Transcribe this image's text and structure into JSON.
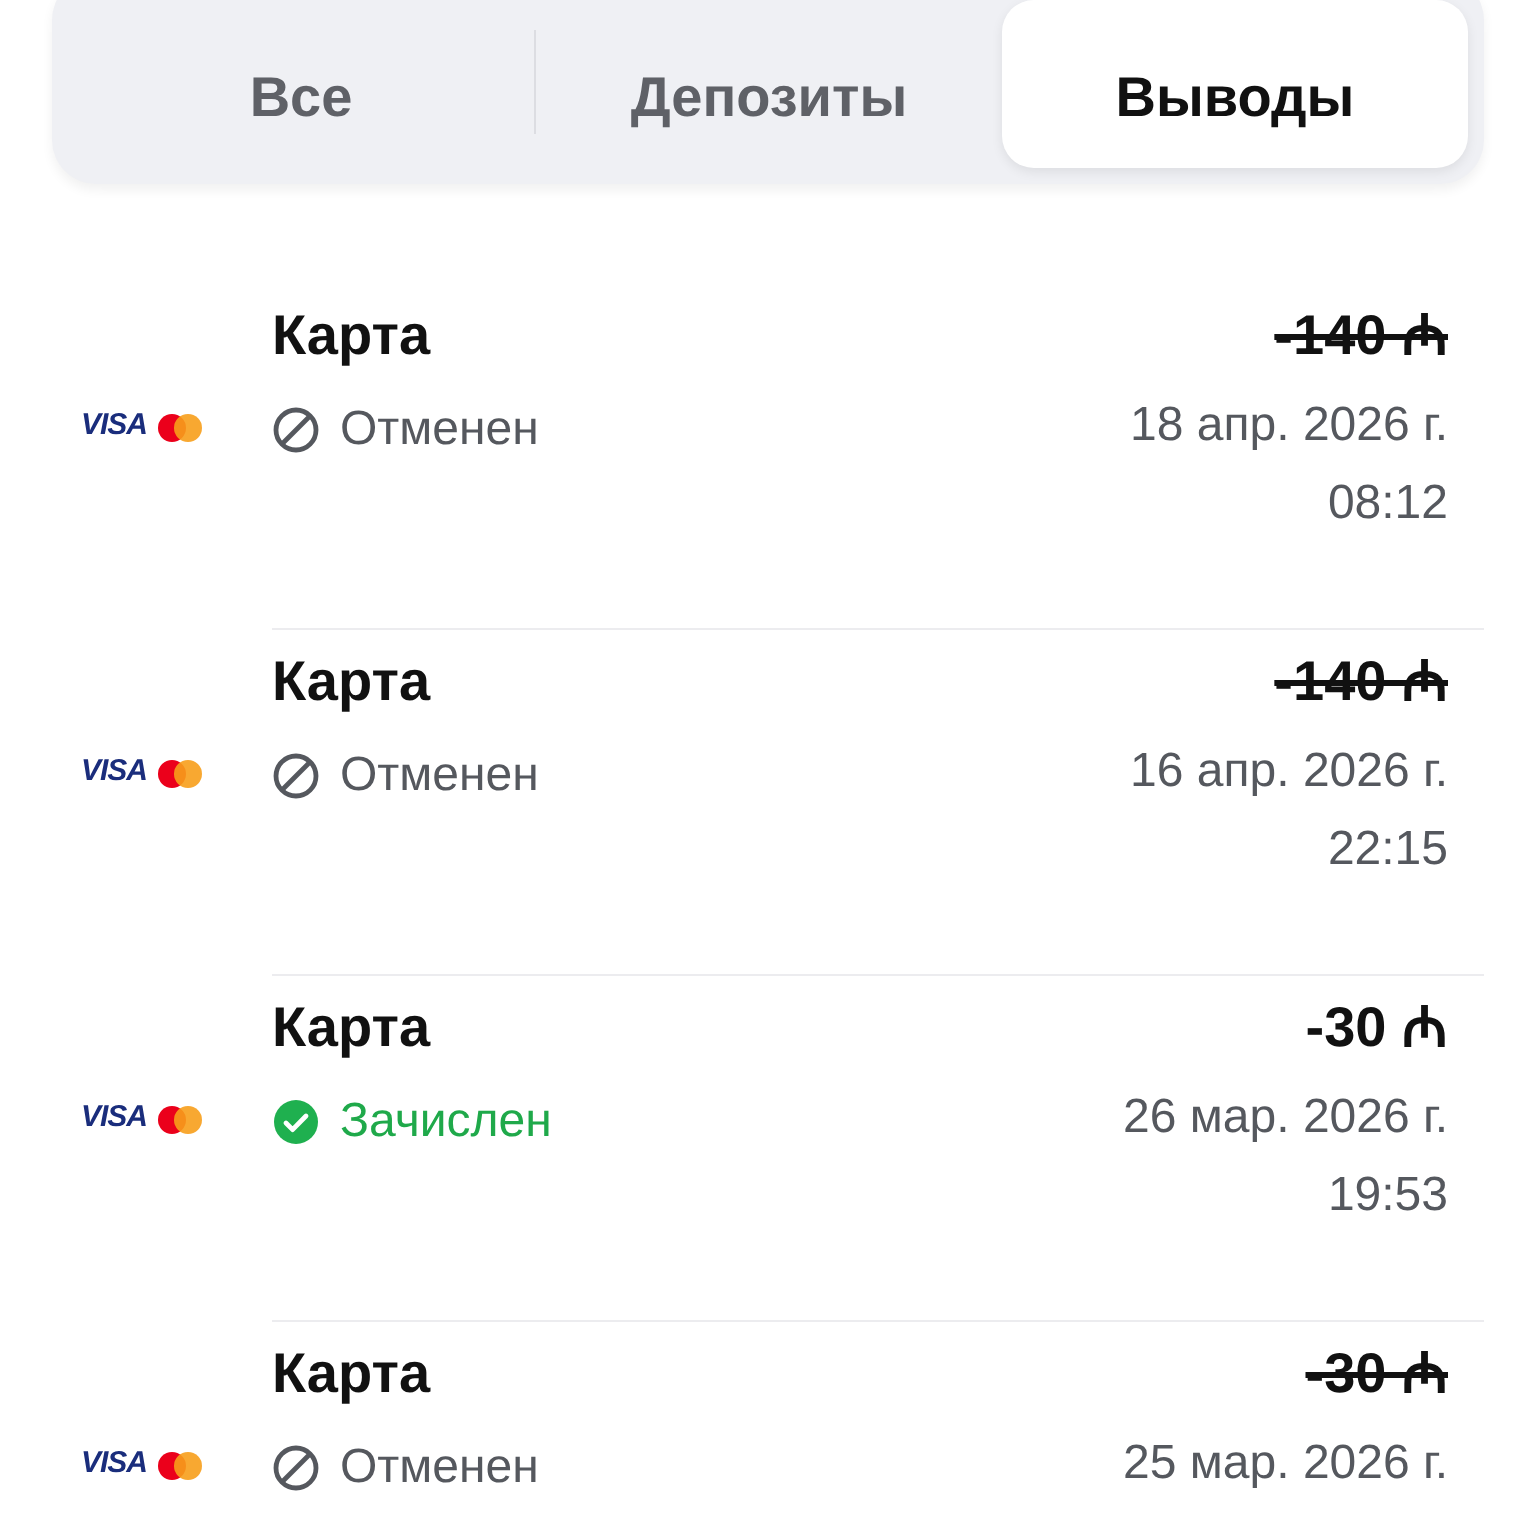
{
  "tabs": [
    {
      "label": "Все",
      "selected": false
    },
    {
      "label": "Депозиты",
      "selected": false
    },
    {
      "label": "Выводы",
      "selected": true
    }
  ],
  "transactions": [
    {
      "card_brand": "VISA",
      "method": "Карта",
      "status": {
        "kind": "cancelled",
        "label": "Отменен"
      },
      "amount": "-140 ₼",
      "date": "18 апр. 2026 г.",
      "time": "08:12"
    },
    {
      "card_brand": "VISA",
      "method": "Карта",
      "status": {
        "kind": "cancelled",
        "label": "Отменен"
      },
      "amount": "-140 ₼",
      "date": "16 апр. 2026 г.",
      "time": "22:15"
    },
    {
      "card_brand": "VISA",
      "method": "Карта",
      "status": {
        "kind": "credited",
        "label": "Зачислен"
      },
      "amount": "-30 ₼",
      "date": "26 мар. 2026 г.",
      "time": "19:53"
    },
    {
      "card_brand": "VISA",
      "method": "Карта",
      "status": {
        "kind": "cancelled",
        "label": "Отменен"
      },
      "amount": "-30 ₼",
      "date": "25 мар. 2026 г."
    }
  ]
}
